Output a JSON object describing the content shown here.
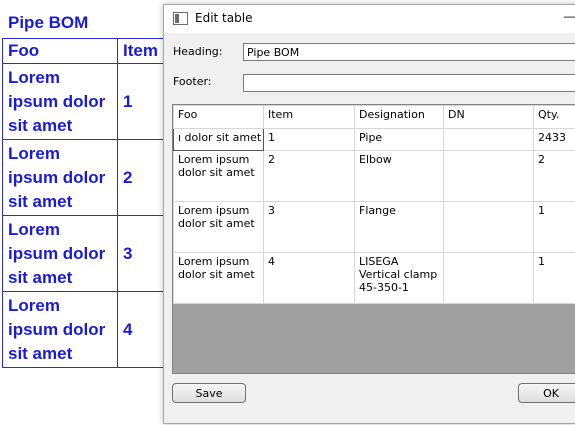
{
  "background": {
    "title": "Pipe BOM",
    "header": {
      "foo": "Foo",
      "item": "Item"
    },
    "rows": [
      {
        "foo": "Lorem ipsum dolor sit amet",
        "item": "1"
      },
      {
        "foo": "Lorem ipsum dolor sit amet",
        "item": "2"
      },
      {
        "foo": "Lorem ipsum dolor sit amet",
        "item": "3"
      },
      {
        "foo": "Lorem ipsum dolor sit amet",
        "item": "4"
      }
    ]
  },
  "dialog": {
    "title": "Edit table",
    "minimize": "—",
    "heading_label": "Heading:",
    "heading_value": "Pipe BOM",
    "footer_label": "Footer:",
    "footer_value": "",
    "columns": [
      "Foo",
      "Item",
      "Designation",
      "DN",
      "Qty."
    ],
    "rows": [
      [
        "ı dolor sit amet",
        "1",
        "Pipe",
        "",
        "2433"
      ],
      [
        "Lorem ipsum dolor sit amet",
        "2",
        "Elbow",
        "",
        "2"
      ],
      [
        "Lorem ipsum dolor sit amet",
        "3",
        "Flange",
        "",
        "1"
      ],
      [
        "Lorem ipsum dolor sit amet",
        "4",
        "LISEGA Vertical clamp 45-350-1",
        "",
        "1"
      ]
    ],
    "save_label": "Save",
    "ok_label": "OK"
  },
  "colors": {
    "drawing_text": "#1a1ad9",
    "dialog_bg": "#f0f0f0",
    "grid_empty": "#a0a0a0"
  }
}
